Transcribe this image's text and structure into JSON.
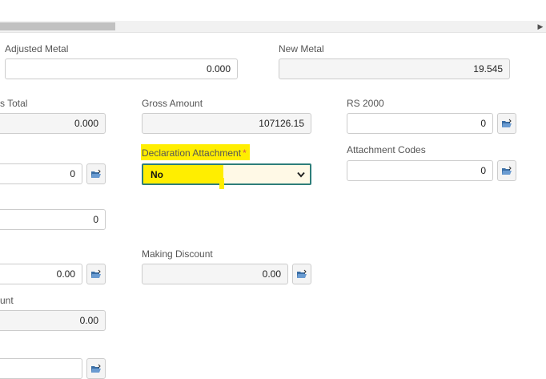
{
  "form": {
    "adjusted_metal": {
      "label": "Adjusted Metal",
      "value": "0.000"
    },
    "new_metal": {
      "label": "New Metal",
      "value": "19.545"
    },
    "total": {
      "label": "s Total",
      "value": "0.000"
    },
    "gross_amount": {
      "label": "Gross Amount",
      "value": "107126.15"
    },
    "rs_2000": {
      "label": "RS 2000",
      "value": "0"
    },
    "left_field_1": {
      "value": "0"
    },
    "declaration_attachment": {
      "label": "Declaration Attachment",
      "required_mark": "*",
      "selected": "No"
    },
    "attachment_codes": {
      "label": "Attachment Codes",
      "value": "0"
    },
    "left_field_2": {
      "value": "0"
    },
    "left_field_3": {
      "value": "0.00"
    },
    "making_discount": {
      "label": "Making Discount",
      "value": "0.00"
    },
    "amount": {
      "label": "unt",
      "value": "0.00"
    },
    "left_field_5": {
      "value": ""
    }
  },
  "icons": {
    "attach": "folder-attach-icon"
  },
  "colors": {
    "highlight": "#ffee00",
    "focus_border": "#2e7e7a",
    "required": "#d9534f"
  }
}
